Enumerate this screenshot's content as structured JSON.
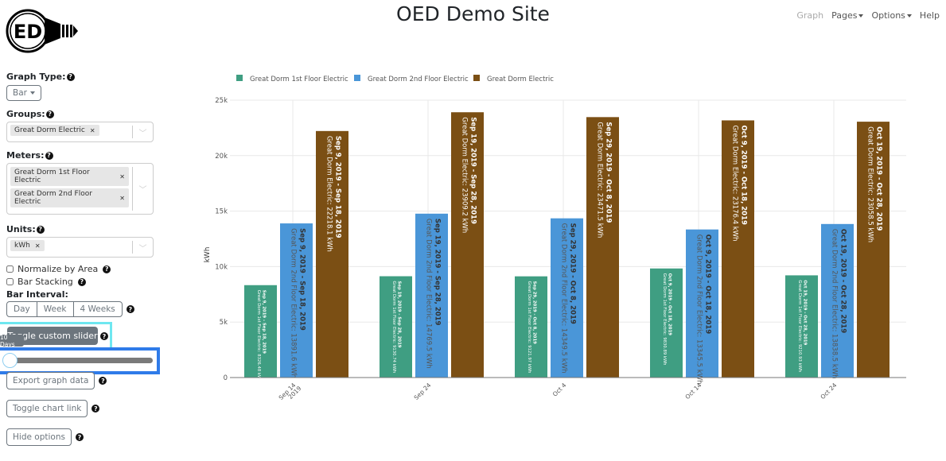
{
  "header": {
    "site_title": "OED Demo Site",
    "logo_text": "ED",
    "nav": {
      "graph": "Graph",
      "pages": "Pages",
      "options": "Options",
      "help": "Help"
    }
  },
  "sidebar": {
    "graph_type_label": "Graph Type:",
    "graph_type_value": "Bar",
    "groups_label": "Groups:",
    "groups_selected": [
      "Great Dorm Electric"
    ],
    "meters_label": "Meters:",
    "meters_selected": [
      "Great Dorm 1st Floor Electric",
      "Great Dorm 2nd Floor Electric"
    ],
    "units_label": "Units:",
    "units_selected": [
      "kWh"
    ],
    "normalize_label": "Normalize by Area",
    "normalize_checked": false,
    "stacking_label": "Bar Stacking",
    "stacking_checked": false,
    "interval_label": "Bar Interval:",
    "interval_options": [
      "Day",
      "Week",
      "4 Weeks"
    ],
    "toggle_slider_label": "Toggle custom slider",
    "slider_tooltip": "10 Days",
    "slider_value_days": 10,
    "export_label": "Export graph data",
    "chart_link_label": "Toggle chart link",
    "hide_options_label": "Hide options",
    "help_glyph": "?"
  },
  "colors": {
    "first_floor": "#3f9e82",
    "second_floor": "#4a96d8",
    "dorm": "#7b4f14",
    "highlight_cyan": "#6ee7f0",
    "highlight_blue": "#2f7be9"
  },
  "chart_data": {
    "type": "bar",
    "title": "",
    "xlabel": "",
    "ylabel": "kWh",
    "ylim": [
      0,
      26500
    ],
    "yticks": [
      0,
      5000,
      10000,
      15000,
      20000,
      25000
    ],
    "ytick_labels": [
      "0",
      "5k",
      "10k",
      "15k",
      "20k",
      "25k"
    ],
    "grid": true,
    "legend_position": "top-left",
    "categories": [
      "Sep 14\n2019",
      "Sep 24",
      "Oct 4",
      "Oct 14",
      "Oct 24"
    ],
    "ranges": [
      "Sep 9, 2019 - Sep 18, 2019",
      "Sep 19, 2019 - Sep 28, 2019",
      "Sep 29, 2019 - Oct 8, 2019",
      "Oct 9, 2019 - Oct 18, 2019",
      "Oct 19, 2019 - Oct 28, 2019"
    ],
    "unit": "kWh",
    "series": [
      {
        "name": "Great Dorm 1st Floor Electric",
        "values": [
          8326.48,
          9130.74,
          9121.97,
          9830.89,
          9210.93
        ],
        "labels": [
          "8326.48",
          "9130.74",
          "9121.97",
          "9830.89",
          "9210.93"
        ]
      },
      {
        "name": "Great Dorm 2nd Floor Electric",
        "values": [
          13891.6,
          14769.5,
          14349.5,
          13345.5,
          13838.5
        ],
        "labels": [
          "13891.6",
          "14769.5",
          "14349.5",
          "13345.5",
          "13838.5"
        ]
      },
      {
        "name": "Great Dorm Electric",
        "values": [
          22218.1,
          23909.2,
          23471.5,
          23176.4,
          23058.5
        ],
        "labels": [
          "22218.1",
          "23909.2",
          "23471.5",
          "23176.4",
          "23058.5"
        ]
      }
    ]
  }
}
